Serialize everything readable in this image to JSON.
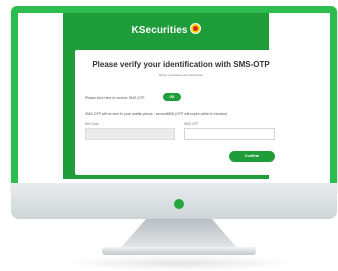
{
  "logo": {
    "text": "KSecurities",
    "emblem_icon": "kasikorn-emblem-icon"
  },
  "dialog": {
    "title": "Please verify your identification with SMS-OTP",
    "subtitle": "before processing the transaction",
    "request_instruction": "Please click here to receive SMS-OTP",
    "ok_label": "OK",
    "otp_notice": "SMS-OTP will be sent to your mobile phone : xxxxxx8808 (OTP will expire within 5 minutes)",
    "ref_code_label": "Ref Code",
    "ref_code_value": "",
    "sms_otp_label": "SMS-OTP",
    "sms_otp_value": "",
    "confirm_label": "Confirm"
  },
  "colors": {
    "brand_green": "#1f9d3a",
    "bezel_green": "#2dbd4e"
  }
}
